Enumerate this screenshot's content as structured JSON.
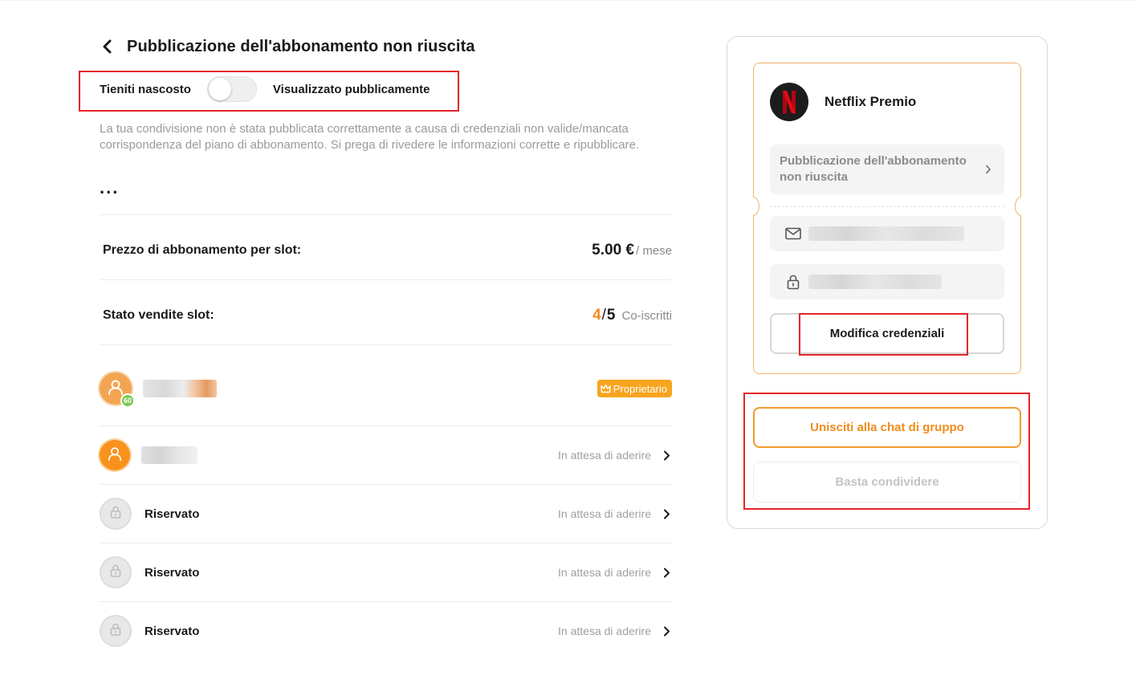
{
  "header": {
    "title": "Pubblicazione dell'abbonamento non riuscita"
  },
  "visibility": {
    "hidden_label": "Tieniti nascosto",
    "public_label": "Visualizzato pubblicamente",
    "is_public": false
  },
  "notice": {
    "description": "La tua condivisione non è stata pubblicata correttamente a causa di credenziali non valide/mancata corrispondenza del piano di abbonamento. Si prega di rivedere le informazioni corrette e ripubblicare.",
    "more": "..."
  },
  "price": {
    "label": "Prezzo di abbonamento per slot:",
    "value": "5.00 €",
    "unit": "/ mese"
  },
  "slots": {
    "label": "Stato vendite slot:",
    "sold": "4",
    "separator": "/",
    "total": "5",
    "unit": "Co-iscritti"
  },
  "members": [
    {
      "type": "owner",
      "level": "60",
      "badge": "Proprietario"
    },
    {
      "type": "pending",
      "status": "In attesa di aderire"
    },
    {
      "type": "reserved",
      "name": "Riservato",
      "status": "In attesa di aderire"
    },
    {
      "type": "reserved",
      "name": "Riservato",
      "status": "In attesa di aderire"
    },
    {
      "type": "reserved",
      "name": "Riservato",
      "status": "In attesa di aderire"
    }
  ],
  "panel": {
    "service_name": "Netflix Premio",
    "service_icon": "netflix-logo-icon",
    "status_text": "Pubblicazione dell'abbonamento non riuscita",
    "email_icon": "mail-icon",
    "password_icon": "lock-icon",
    "edit_button": "Modifica credenziali",
    "chat_button": "Unisciti alla chat di gruppo",
    "share_button": "Basta condividere"
  },
  "colors": {
    "accent": "#f08c1d",
    "highlight": "#e5252a",
    "owner_badge": "#f7a41f",
    "level_badge": "#7cc653",
    "netflix_red": "#e50914"
  }
}
